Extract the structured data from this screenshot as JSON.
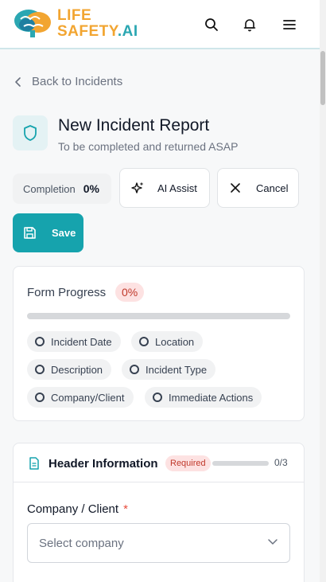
{
  "brand": {
    "line1": "LIFE",
    "line2a": "SAFETY",
    "line2b": ".AI"
  },
  "header": {
    "icons": [
      "search-icon",
      "bell-icon",
      "menu-icon"
    ]
  },
  "nav": {
    "back_label": "Back to Incidents"
  },
  "page": {
    "title": "New Incident Report",
    "subtitle": "To be completed and returned ASAP"
  },
  "actions": {
    "completion_label": "Completion",
    "completion_value": "0%",
    "ai_assist_label": "AI Assist",
    "cancel_label": "Cancel",
    "save_label": "Save"
  },
  "form_progress": {
    "title": "Form Progress",
    "percent_label": "0%",
    "percent": 0,
    "items": [
      "Incident Date",
      "Location",
      "Description",
      "Incident Type",
      "Company/Client",
      "Immediate Actions"
    ]
  },
  "section": {
    "title": "Header Information",
    "required_label": "Required",
    "progress": 0,
    "count": "0/3",
    "field_label": "Company / Client",
    "required_mark": "*",
    "select_placeholder": "Select company"
  },
  "colors": {
    "accent": "#16a3ad",
    "brand_orange": "#f2a531",
    "danger": "#c0392b"
  }
}
